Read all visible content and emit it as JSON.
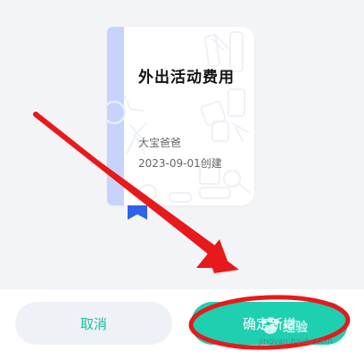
{
  "ledger_card": {
    "title": "外出活动费用",
    "owner": "大宝爸爸",
    "created": "2023-09-01创建"
  },
  "actions": {
    "cancel_label": "取消",
    "confirm_label": "确定新增"
  },
  "watermark": {
    "logo": "Baidu",
    "word": "经验",
    "url": "jingyan.baidu.com"
  },
  "colors": {
    "accent": "#1ecfb0",
    "spine": "#c6d4fb",
    "bookmark": "#2f62e8",
    "annotation": "#e8191c"
  },
  "icons": {
    "bookmark": "bookmark-ribbon-icon",
    "pattern": "stationery-doodle-pattern"
  }
}
